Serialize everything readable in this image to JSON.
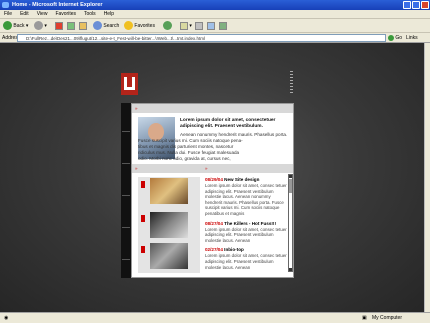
{
  "window": {
    "title": "Home - Microsoft Internet Explorer"
  },
  "menu": [
    "File",
    "Edit",
    "View",
    "Favorites",
    "Tools",
    "Help"
  ],
  "toolbar": {
    "back": "Back",
    "search": "Search",
    "favorites": "Favorites"
  },
  "address": {
    "label": "Address",
    "url": "D:\\FullRez...de\\Des21...09\\flugut/12...site-e-t_Fest-will-be-bitter...\\!Web...t\\...tmt.index.html",
    "go": "Go",
    "links": "Links"
  },
  "status": {
    "zone": "My Computer"
  },
  "site": {
    "logo_letter": "U",
    "main_article": {
      "title": "Lorem ipsum dolor sit amet, consectetuer adipiscing elit. Praesent vestibulum.",
      "text": [
        "Aenean nonummy hendrerit mauris. Phasellus porta.",
        "Fusce suscipit varius mi. Cum sociis natoque pena-",
        "tibus et magnis dis parturient montes, nascetur",
        "ridiculus mus. Nulla dui. Fusce feugiat malesuada",
        "odio. Morbi nunc odio, gravida at, cursus nec,"
      ]
    },
    "news": [
      {
        "date": "08/29/04",
        "title": "New Site design",
        "text": "Lorem ipsum dolor sit amet, consec tetuer adipiscing elit. Praesent vestibulum molestie lacus. Aenean nonummy hendrerit mauris. Phasellus porta. Fusce suscipit varius mi. Cum sociis natoque penatibus et magnis"
      },
      {
        "date": "08/27/04",
        "title": "The Killers - Hot Fuss!!!",
        "text": "Lorem ipsum dolor sit amet, consec tetuer adipiscing elit. Praesent vestibulum molestie lacus. Aenean"
      },
      {
        "date": "02/27/04",
        "title": "Inbio-top",
        "text": "Lorem ipsum dolor sit amet, consec tetuer adipiscing elit. Praesent vestibulum molestie lacus. Aenean"
      }
    ]
  }
}
